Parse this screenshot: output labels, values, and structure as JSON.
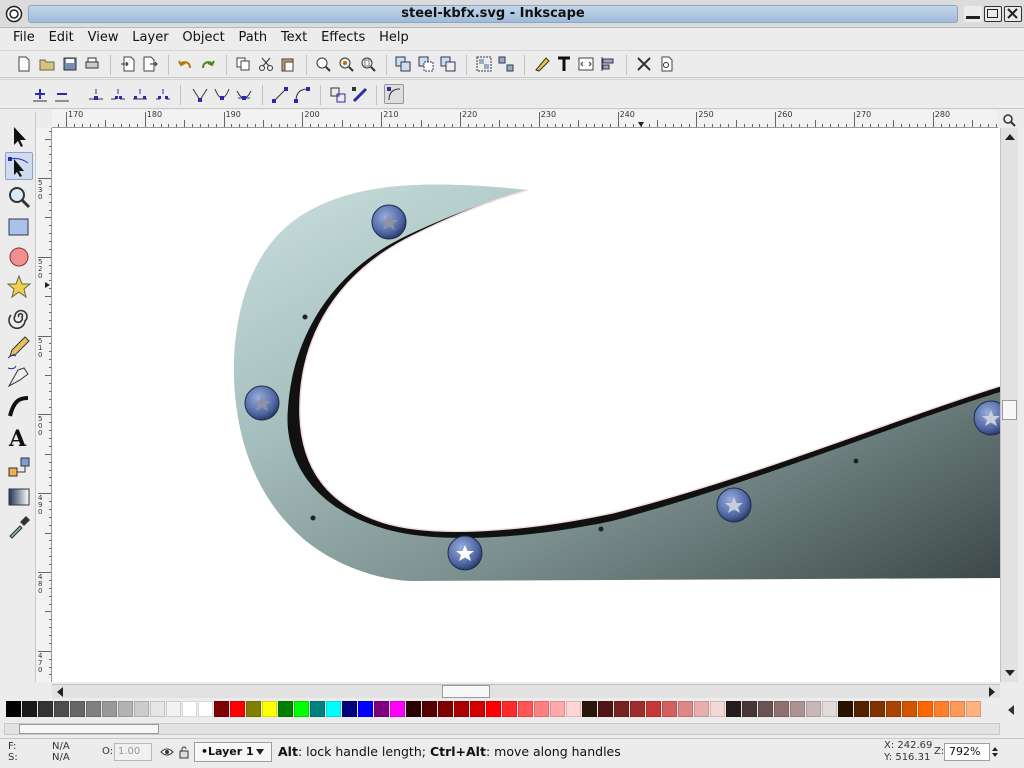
{
  "window": {
    "title": "steel-kbfx.svg - Inkscape"
  },
  "menu": [
    "File",
    "Edit",
    "View",
    "Layer",
    "Object",
    "Path",
    "Text",
    "Effects",
    "Help"
  ],
  "toolbar": {
    "commands": [
      "new-document-icon",
      "open-icon",
      "save-icon",
      "print-icon",
      "import-icon",
      "export-icon",
      "undo-icon",
      "redo-icon",
      "copy-icon",
      "cut-icon",
      "paste-icon",
      "zoom-selection-icon",
      "zoom-drawing-icon",
      "zoom-page-icon",
      "duplicate-icon",
      "clone-icon",
      "unlink-clone-icon",
      "group-icon",
      "ungroup-icon",
      "fill-stroke-icon",
      "text-font-icon",
      "xml-editor-icon",
      "align-icon",
      "preferences-icon",
      "document-properties-icon"
    ],
    "node_controls": [
      "insert-node-icon",
      "delete-node-icon",
      "join-nodes-icon",
      "break-path-icon",
      "join-segment-icon",
      "delete-segment-icon",
      "cusp-node-icon",
      "smooth-node-icon",
      "symmetric-node-icon",
      "line-segment-icon",
      "curve-segment-icon",
      "object-to-path-icon",
      "stroke-to-path-icon",
      "show-handles-icon"
    ]
  },
  "tools": [
    "selector-tool-icon",
    "node-tool-icon",
    "zoom-tool-icon",
    "rectangle-tool-icon",
    "ellipse-tool-icon",
    "star-tool-icon",
    "spiral-tool-icon",
    "pencil-tool-icon",
    "pen-tool-icon",
    "calligraphy-tool-icon",
    "text-tool-icon",
    "connector-tool-icon",
    "gradient-tool-icon",
    "dropper-tool-icon"
  ],
  "ruler": {
    "horizontal_labels": [
      "170",
      "180",
      "190",
      "200",
      "210",
      "220",
      "230",
      "240",
      "250",
      "260",
      "270",
      "280"
    ],
    "vertical_labels": [
      "5\n3\n0",
      "5\n2\n0",
      "5\n1\n0",
      "5\n0\n0",
      "4\n9\n0",
      "4\n8\n0",
      "4\n7\n0"
    ]
  },
  "palette": [
    "#000000",
    "#1a1a1a",
    "#333333",
    "#4d4d4d",
    "#666666",
    "#808080",
    "#999999",
    "#b3b3b3",
    "#cccccc",
    "#e6e6e6",
    "#f2f2f2",
    "#ffffff",
    "#ffffff",
    "#800000",
    "#ff0000",
    "#808000",
    "#ffff00",
    "#008000",
    "#00ff00",
    "#008080",
    "#00ffff",
    "#000080",
    "#0000ff",
    "#800080",
    "#ff00ff",
    "#2b0000",
    "#550000",
    "#800000",
    "#aa0000",
    "#d40000",
    "#ff0000",
    "#ff2a2a",
    "#ff5555",
    "#ff8080",
    "#ffaaaa",
    "#ffd5d5",
    "#28170b",
    "#501616",
    "#782121",
    "#a02c2c",
    "#c83737",
    "#d35f5f",
    "#de8787",
    "#e9afaf",
    "#f4d7d7",
    "#241c1c",
    "#483737",
    "#6c5353",
    "#916f6f",
    "#ac9393",
    "#c8b7b7",
    "#e3dbdb",
    "#2b1100",
    "#552200",
    "#803300",
    "#aa4400",
    "#d45500",
    "#ff6600",
    "#ff7f2a",
    "#ff9955",
    "#ffb380"
  ],
  "status": {
    "fill_label": "F:",
    "fill_value": "N/A",
    "stroke_label": "S:",
    "stroke_value": "N/A",
    "opacity_label": "O:",
    "opacity_value": "1.00",
    "layer": "•Layer 1",
    "message_bold1": "Alt",
    "message_text1": ": lock handle length; ",
    "message_bold2": "Ctrl+Alt",
    "message_text2": ": move along handles",
    "x_coord": "X: 242.69",
    "y_coord": "Y: 516.31",
    "zoom_label": "Z:",
    "zoom_value": "792%"
  },
  "colors": {
    "shape_light": "#c5dcdc",
    "shape_dark": "#4a5656",
    "rivet": "#5d74a8",
    "accent": "#2233bb"
  }
}
